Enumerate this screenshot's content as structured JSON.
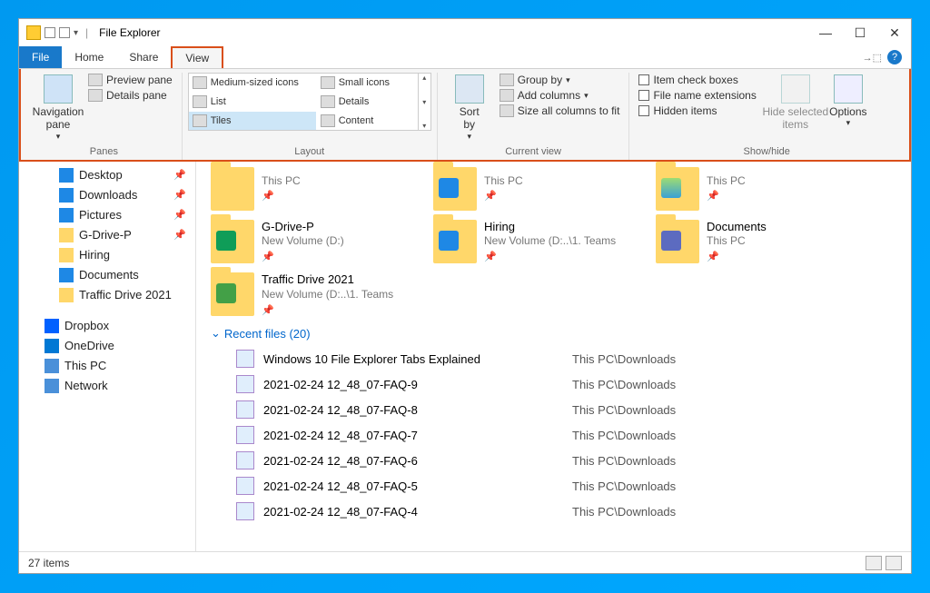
{
  "titlebar": {
    "title": "File Explorer"
  },
  "tabs": {
    "file": "File",
    "home": "Home",
    "share": "Share",
    "view": "View"
  },
  "ribbon": {
    "panes": {
      "nav": "Navigation\npane",
      "preview": "Preview pane",
      "details": "Details pane",
      "label": "Panes"
    },
    "layout": {
      "opts": [
        "Medium-sized icons",
        "Small icons",
        "List",
        "Details",
        "Tiles",
        "Content"
      ],
      "label": "Layout"
    },
    "current": {
      "sort": "Sort\nby",
      "group": "Group by",
      "addcols": "Add columns",
      "sizeall": "Size all columns to fit",
      "label": "Current view"
    },
    "showhide": {
      "check1": "Item check boxes",
      "check2": "File name extensions",
      "check3": "Hidden items",
      "hidesel": "Hide selected\nitems",
      "options": "Options",
      "label": "Show/hide"
    }
  },
  "sidebar": {
    "items": [
      {
        "label": "Desktop",
        "indent": true,
        "pinned": true,
        "color": "#1e88e5"
      },
      {
        "label": "Downloads",
        "indent": true,
        "pinned": true,
        "color": "#1e88e5"
      },
      {
        "label": "Pictures",
        "indent": true,
        "pinned": true,
        "color": "#1e88e5"
      },
      {
        "label": "G-Drive-P",
        "indent": true,
        "pinned": true,
        "color": "#ffd76a"
      },
      {
        "label": "Hiring",
        "indent": true,
        "pinned": false,
        "color": "#ffd76a"
      },
      {
        "label": "Documents",
        "indent": true,
        "pinned": false,
        "color": "#1e88e5"
      },
      {
        "label": "Traffic Drive 2021",
        "indent": true,
        "pinned": false,
        "color": "#ffd76a"
      },
      {
        "label": "Dropbox",
        "indent": false,
        "pinned": false,
        "color": "#0061ff"
      },
      {
        "label": "OneDrive",
        "indent": false,
        "pinned": false,
        "color": "#0078d4"
      },
      {
        "label": "This PC",
        "indent": false,
        "pinned": false,
        "color": "#4a90d9"
      },
      {
        "label": "Network",
        "indent": false,
        "pinned": false,
        "color": "#4a90d9"
      }
    ]
  },
  "folders": [
    {
      "name": "",
      "sub": "This PC",
      "overlay": ""
    },
    {
      "name": "",
      "sub": "This PC",
      "overlay": "#1e88e5"
    },
    {
      "name": "",
      "sub": "This PC",
      "overlay": "img"
    },
    {
      "name": "G-Drive-P",
      "sub": "New Volume (D:)",
      "overlay": "#0f9d58"
    },
    {
      "name": "Hiring",
      "sub": "New Volume (D:..\\1. Teams",
      "overlay": "#1e88e5"
    },
    {
      "name": "Documents",
      "sub": "This PC",
      "overlay": "#5c6bc0"
    },
    {
      "name": "Traffic Drive 2021",
      "sub": "New Volume (D:..\\1. Teams",
      "overlay": "#43a047"
    }
  ],
  "recent": {
    "header": "Recent files (20)",
    "rows": [
      {
        "name": "Windows 10 File Explorer Tabs Explained",
        "path": "This PC\\Downloads"
      },
      {
        "name": "2021-02-24 12_48_07-FAQ-9",
        "path": "This PC\\Downloads"
      },
      {
        "name": "2021-02-24 12_48_07-FAQ-8",
        "path": "This PC\\Downloads"
      },
      {
        "name": "2021-02-24 12_48_07-FAQ-7",
        "path": "This PC\\Downloads"
      },
      {
        "name": "2021-02-24 12_48_07-FAQ-6",
        "path": "This PC\\Downloads"
      },
      {
        "name": "2021-02-24 12_48_07-FAQ-5",
        "path": "This PC\\Downloads"
      },
      {
        "name": "2021-02-24 12_48_07-FAQ-4",
        "path": "This PC\\Downloads"
      }
    ]
  },
  "status": {
    "items": "27 items"
  }
}
